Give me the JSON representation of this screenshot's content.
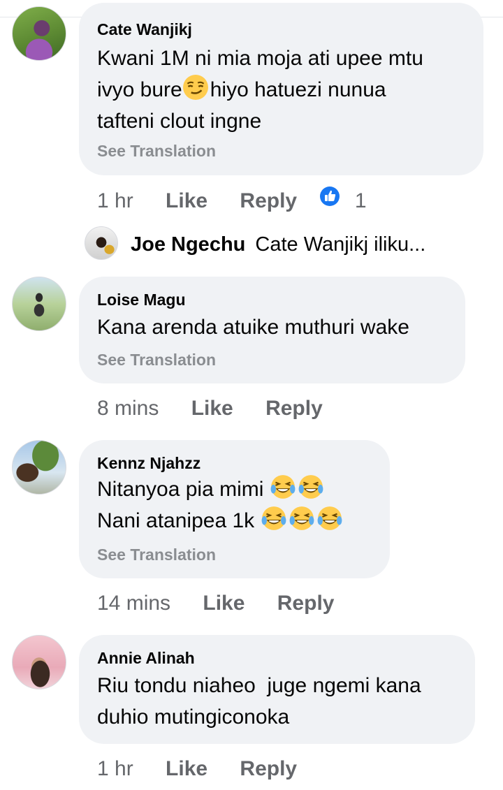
{
  "comments": [
    {
      "author": "Cate Wanjikj",
      "lines": [
        "Kwani 1M ni mia moja ati upee mtu",
        "ivyo bure",
        "hiyo hatuezi nunua",
        "tafteni clout ingne"
      ],
      "see_translation": "See Translation",
      "time": "1 hr",
      "like": "Like",
      "reply": "Reply",
      "reaction_count": "1"
    },
    {
      "author": "Loise Magu",
      "lines": [
        "Kana arenda atuike muthuri wake"
      ],
      "see_translation": "See Translation",
      "time": "8 mins",
      "like": "Like",
      "reply": "Reply"
    },
    {
      "author": "Kennz Njahzz",
      "lines": [
        "Nitanyoa pia mimi",
        "Nani atanipea 1k"
      ],
      "see_translation": "See Translation",
      "time": "14 mins",
      "like": "Like",
      "reply": "Reply"
    },
    {
      "author": "Annie Alinah",
      "lines": [
        "Riu tondu niaheo  juge ngemi kana",
        "duhio mutingiconoka"
      ],
      "time": "1 hr",
      "like": "Like",
      "reply": "Reply"
    }
  ],
  "reply_preview": {
    "author": "Joe Ngechu",
    "snippet": "Cate Wanjikj iliku..."
  },
  "icons": {
    "smirk": "smirk-emoji-icon",
    "laugh": "laughing-tears-emoji-icon",
    "like_badge": "like-reaction-icon"
  },
  "colors": {
    "bubble": "#f0f2f5",
    "meta_text": "#65676b",
    "like_blue": "#1877f2",
    "emoji_yellow": "#ffcc4d"
  }
}
